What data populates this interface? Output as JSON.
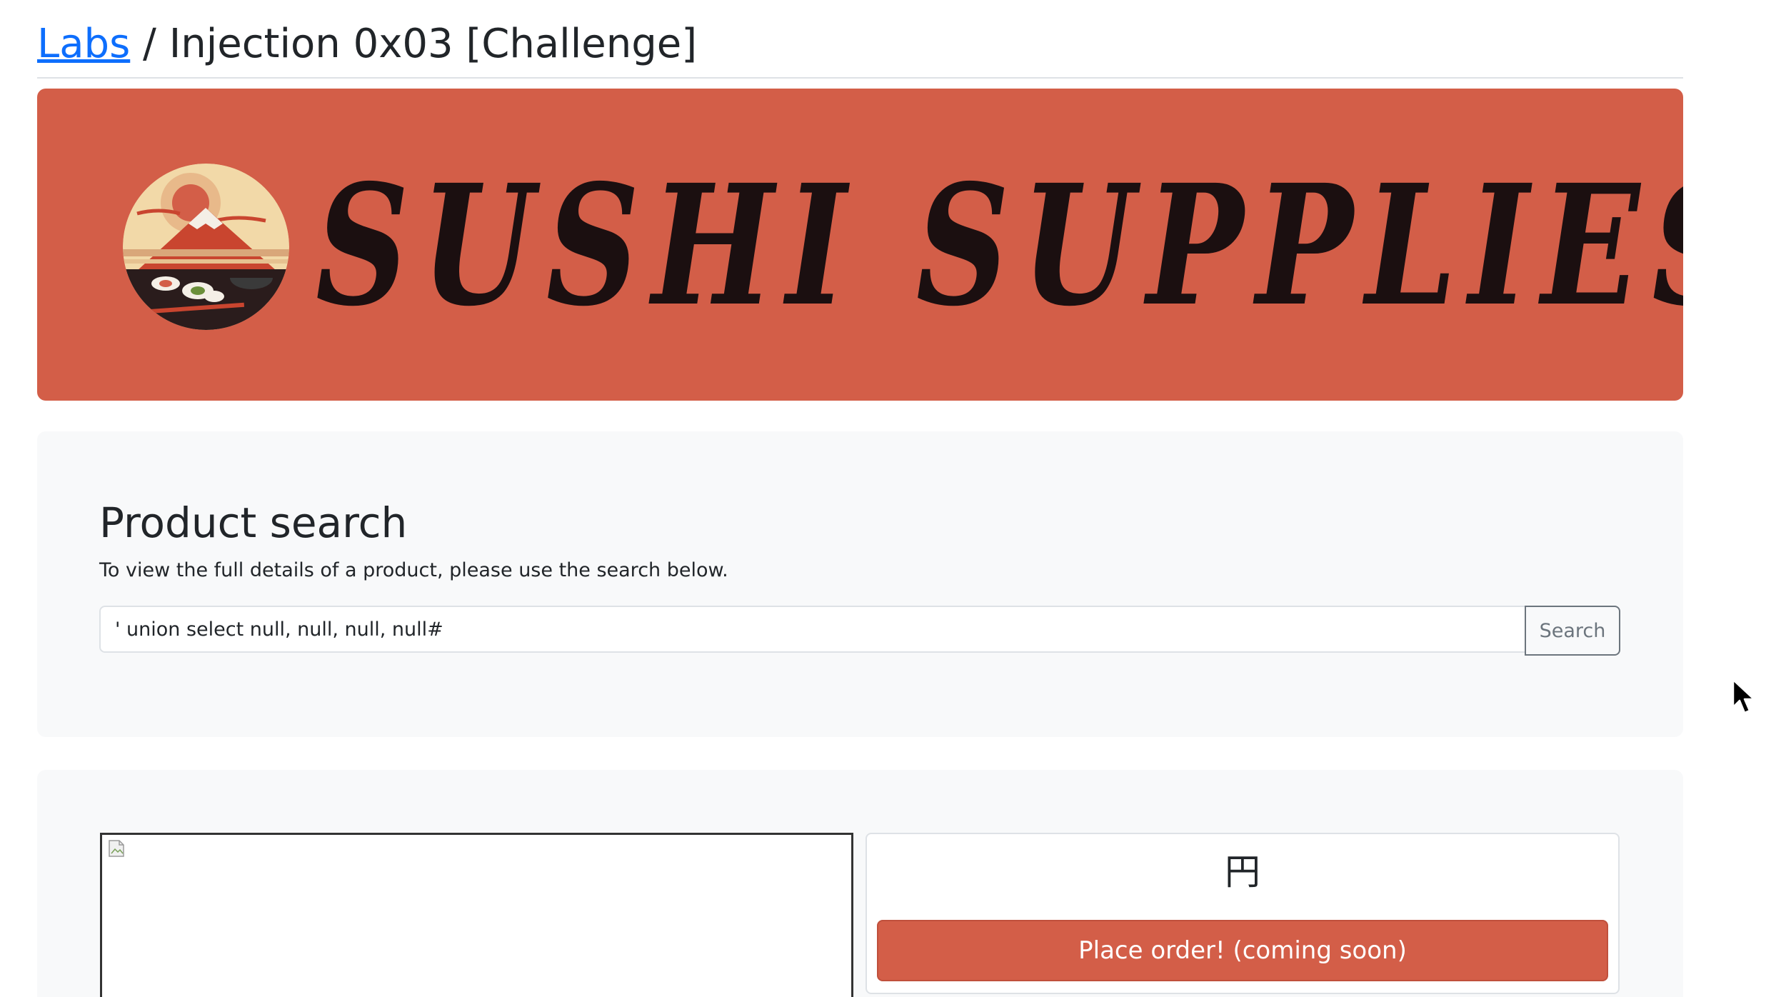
{
  "breadcrumb": {
    "link": "Labs",
    "separator": " / ",
    "current": "Injection 0x03 [Challenge]"
  },
  "banner": {
    "title": "SUSHI SUPPLIES",
    "color": "#d35e48"
  },
  "search": {
    "title": "Product search",
    "description": "To view the full details of a product, please use the search below.",
    "input_value": "' union select null, null, null, null#",
    "button_label": "Search"
  },
  "product": {
    "price": "円",
    "order_button_label": "Place order! (coming soon)"
  },
  "colors": {
    "accent": "#d35e48",
    "link": "#0d6efd",
    "card_bg": "#f8f9fa"
  }
}
